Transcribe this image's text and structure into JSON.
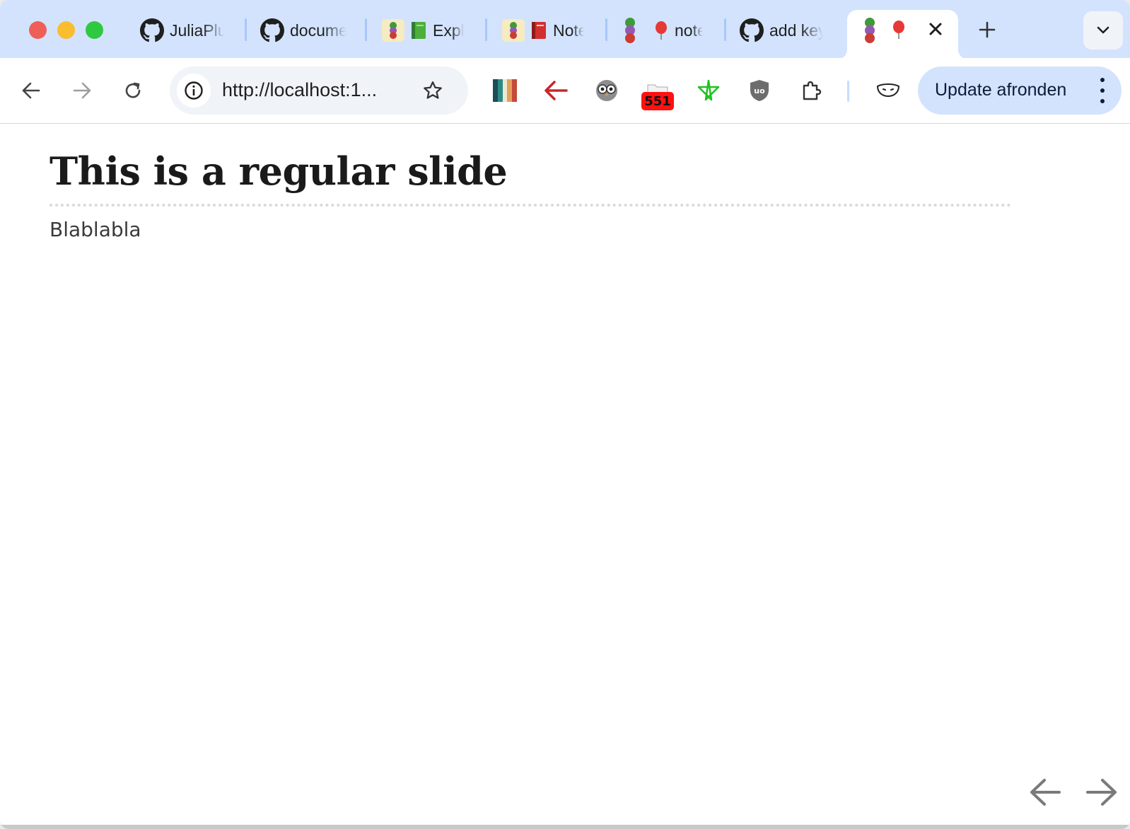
{
  "window": {
    "controls": [
      "close",
      "minimize",
      "maximize"
    ]
  },
  "tabs": [
    {
      "title": "JuliaPluto",
      "favicon": "github-icon"
    },
    {
      "title": "documentation",
      "favicon": "github-icon"
    },
    {
      "title": "Explore",
      "favicon": "pluto-book-green-icon"
    },
    {
      "title": "Notebook",
      "favicon": "pluto-book-red-icon"
    },
    {
      "title": "notebook",
      "favicon": "pluto-balloon-icon"
    },
    {
      "title": "add keyboard",
      "favicon": "github-icon"
    },
    {
      "title": "",
      "favicon": "pluto-balloon-icon",
      "active": true
    }
  ],
  "toolbar": {
    "url": "http://localhost:1...",
    "update_label": "Update afronden",
    "extension_badge": "551",
    "extensions": [
      "color-palette-extension-icon",
      "red-arrow-extension-icon",
      "owl-extension-icon",
      "folder-count-extension-icon",
      "green-star-extension-icon",
      "ublock-shield-icon",
      "puzzle-extensions-icon",
      "mask-profile-icon"
    ]
  },
  "slide": {
    "title": "This is a regular slide",
    "body": "Blablabla"
  },
  "colors": {
    "tabstrip": "#d3e3fd",
    "update_button": "#d3e3fd",
    "badge": "#ff1111"
  }
}
